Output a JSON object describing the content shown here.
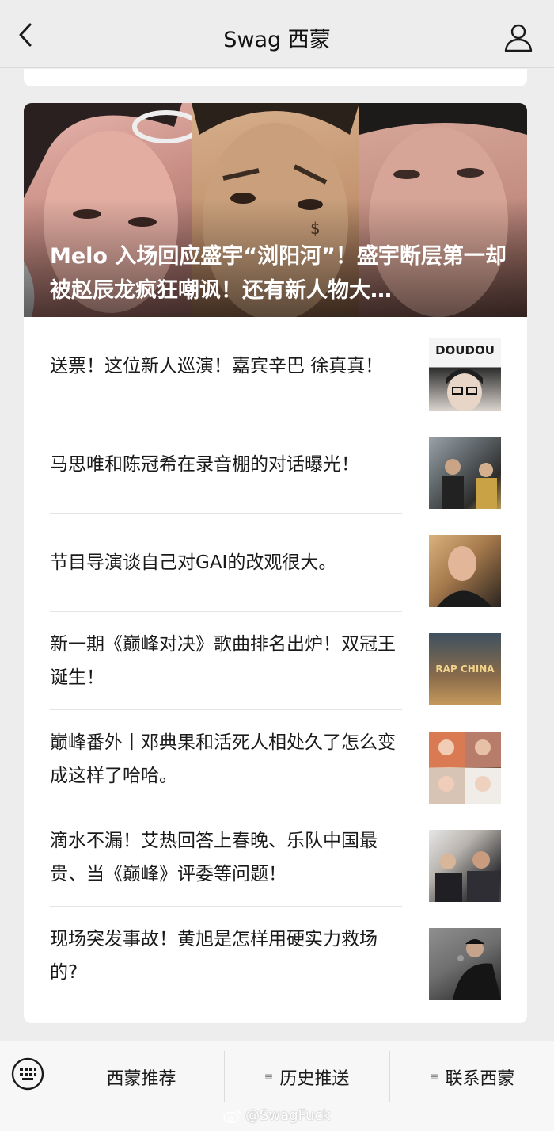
{
  "header": {
    "title": "Swag 西蒙",
    "back_icon": "chevron-left-icon",
    "profile_icon": "user-icon"
  },
  "featured": {
    "title": "Melo 入场回应盛宇“浏阳河”！盛宇断层第一却被赵辰龙疯狂嘲讽！还有新人物大…"
  },
  "articles": [
    {
      "title": "送票！这位新人巡演！嘉宾辛巴 徐真真！",
      "thumb_label": "DOUDOU"
    },
    {
      "title": "马思唯和陈冠希在录音棚的对话曝光！",
      "thumb_label": ""
    },
    {
      "title": "节目导演谈自己对GAI的改观很大。",
      "thumb_label": ""
    },
    {
      "title": "新一期《巅峰对决》歌曲排名出炉！双冠王诞生！",
      "thumb_label": "RAP CHINA"
    },
    {
      "title": "巅峰番外丨邓典果和活死人相处久了怎么变成这样了哈哈。",
      "thumb_label": ""
    },
    {
      "title": "滴水不漏！艾热回答上春晚、乐队中国最贵、当《巅峰》评委等问题！",
      "thumb_label": ""
    },
    {
      "title": "现场突发事故！黄旭是怎样用硬实力救场的?",
      "thumb_label": ""
    }
  ],
  "bottom_menu": {
    "keyboard_icon": "keyboard-icon",
    "items": [
      "西蒙推荐",
      "历史推送",
      "联系西蒙"
    ]
  },
  "watermark": "@SwagFuck"
}
